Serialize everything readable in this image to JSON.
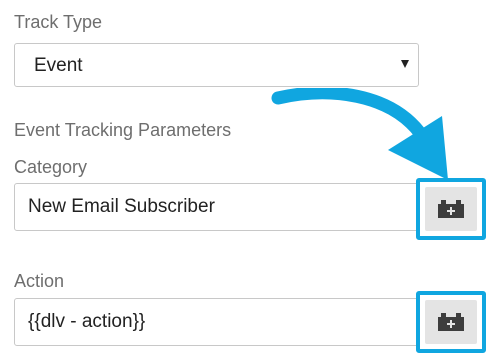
{
  "track_type": {
    "label": "Track Type",
    "selected": "Event"
  },
  "event_tracking": {
    "heading": "Event Tracking Parameters",
    "category": {
      "label": "Category",
      "value": "New Email Subscriber"
    },
    "action": {
      "label": "Action",
      "value": "{{dlv - action}}"
    }
  },
  "icons": {
    "variable_button": "brick-plus-icon",
    "caret": "caret-down-icon",
    "annotation": "curved-arrow-icon"
  },
  "colors": {
    "highlight": "#10a6e0",
    "label": "#6e6e6e",
    "icon": "#3d3d3d",
    "button_bg": "#e4e4e4"
  }
}
